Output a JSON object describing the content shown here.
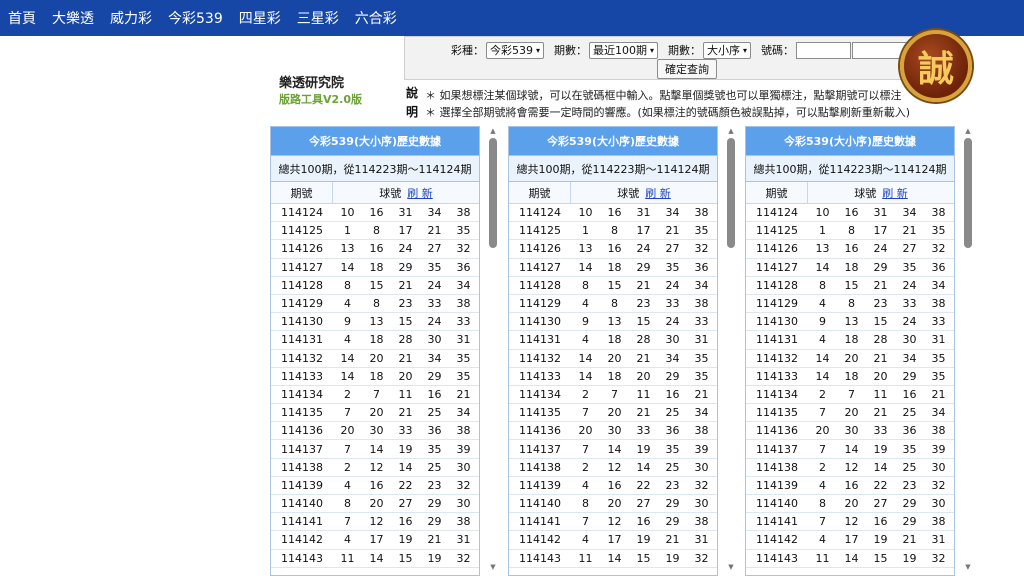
{
  "nav": [
    "首頁",
    "大樂透",
    "威力彩",
    "今彩539",
    "四星彩",
    "三星彩",
    "六合彩"
  ],
  "query": {
    "game_label": "彩種：",
    "game_value": "今彩539",
    "range_label": "期數：",
    "range_value": "最近100期",
    "order_label": "期數：",
    "order_value": "大小序",
    "number_label": "號碼：",
    "submit": "確定查詢"
  },
  "logo": {
    "text": "誠"
  },
  "site": {
    "title": "樂透研究院",
    "version": "版路工具V2.0版"
  },
  "notes": {
    "label": "說明",
    "line1": "＊ 如果想標注某個球號，可以在號碼框中輸入。點擊單個獎號也可以單獨標注，點擊期號可以標注",
    "line2": "＊ 選擇全部期號將會需要一定時間的響應。(如果標注的號碼顏色被誤點掉，可以點擊刷新重新載入)"
  },
  "panel": {
    "title": "今彩539(大小序)歷史數據",
    "summary": "總共100期，從114223期～114124期",
    "col_period": "期號",
    "col_balls": "球號",
    "refresh": "刷 新"
  },
  "rows": [
    {
      "period": "114124",
      "balls": [
        "10",
        "16",
        "31",
        "34",
        "38"
      ]
    },
    {
      "period": "114125",
      "balls": [
        "1",
        "8",
        "17",
        "21",
        "35"
      ]
    },
    {
      "period": "114126",
      "balls": [
        "13",
        "16",
        "24",
        "27",
        "32"
      ]
    },
    {
      "period": "114127",
      "balls": [
        "14",
        "18",
        "29",
        "35",
        "36"
      ]
    },
    {
      "period": "114128",
      "balls": [
        "8",
        "15",
        "21",
        "24",
        "34"
      ]
    },
    {
      "period": "114129",
      "balls": [
        "4",
        "8",
        "23",
        "33",
        "38"
      ]
    },
    {
      "period": "114130",
      "balls": [
        "9",
        "13",
        "15",
        "24",
        "33"
      ]
    },
    {
      "period": "114131",
      "balls": [
        "4",
        "18",
        "28",
        "30",
        "31"
      ]
    },
    {
      "period": "114132",
      "balls": [
        "14",
        "20",
        "21",
        "34",
        "35"
      ]
    },
    {
      "period": "114133",
      "balls": [
        "14",
        "18",
        "20",
        "29",
        "35"
      ]
    },
    {
      "period": "114134",
      "balls": [
        "2",
        "7",
        "11",
        "16",
        "21"
      ]
    },
    {
      "period": "114135",
      "balls": [
        "7",
        "20",
        "21",
        "25",
        "34"
      ]
    },
    {
      "period": "114136",
      "balls": [
        "20",
        "30",
        "33",
        "36",
        "38"
      ]
    },
    {
      "period": "114137",
      "balls": [
        "7",
        "14",
        "19",
        "35",
        "39"
      ]
    },
    {
      "period": "114138",
      "balls": [
        "2",
        "12",
        "14",
        "25",
        "30"
      ]
    },
    {
      "period": "114139",
      "balls": [
        "4",
        "16",
        "22",
        "23",
        "32"
      ]
    },
    {
      "period": "114140",
      "balls": [
        "8",
        "20",
        "27",
        "29",
        "30"
      ]
    },
    {
      "period": "114141",
      "balls": [
        "7",
        "12",
        "16",
        "29",
        "38"
      ]
    },
    {
      "period": "114142",
      "balls": [
        "4",
        "17",
        "19",
        "21",
        "31"
      ]
    },
    {
      "period": "114143",
      "balls": [
        "11",
        "14",
        "15",
        "19",
        "32"
      ]
    }
  ]
}
